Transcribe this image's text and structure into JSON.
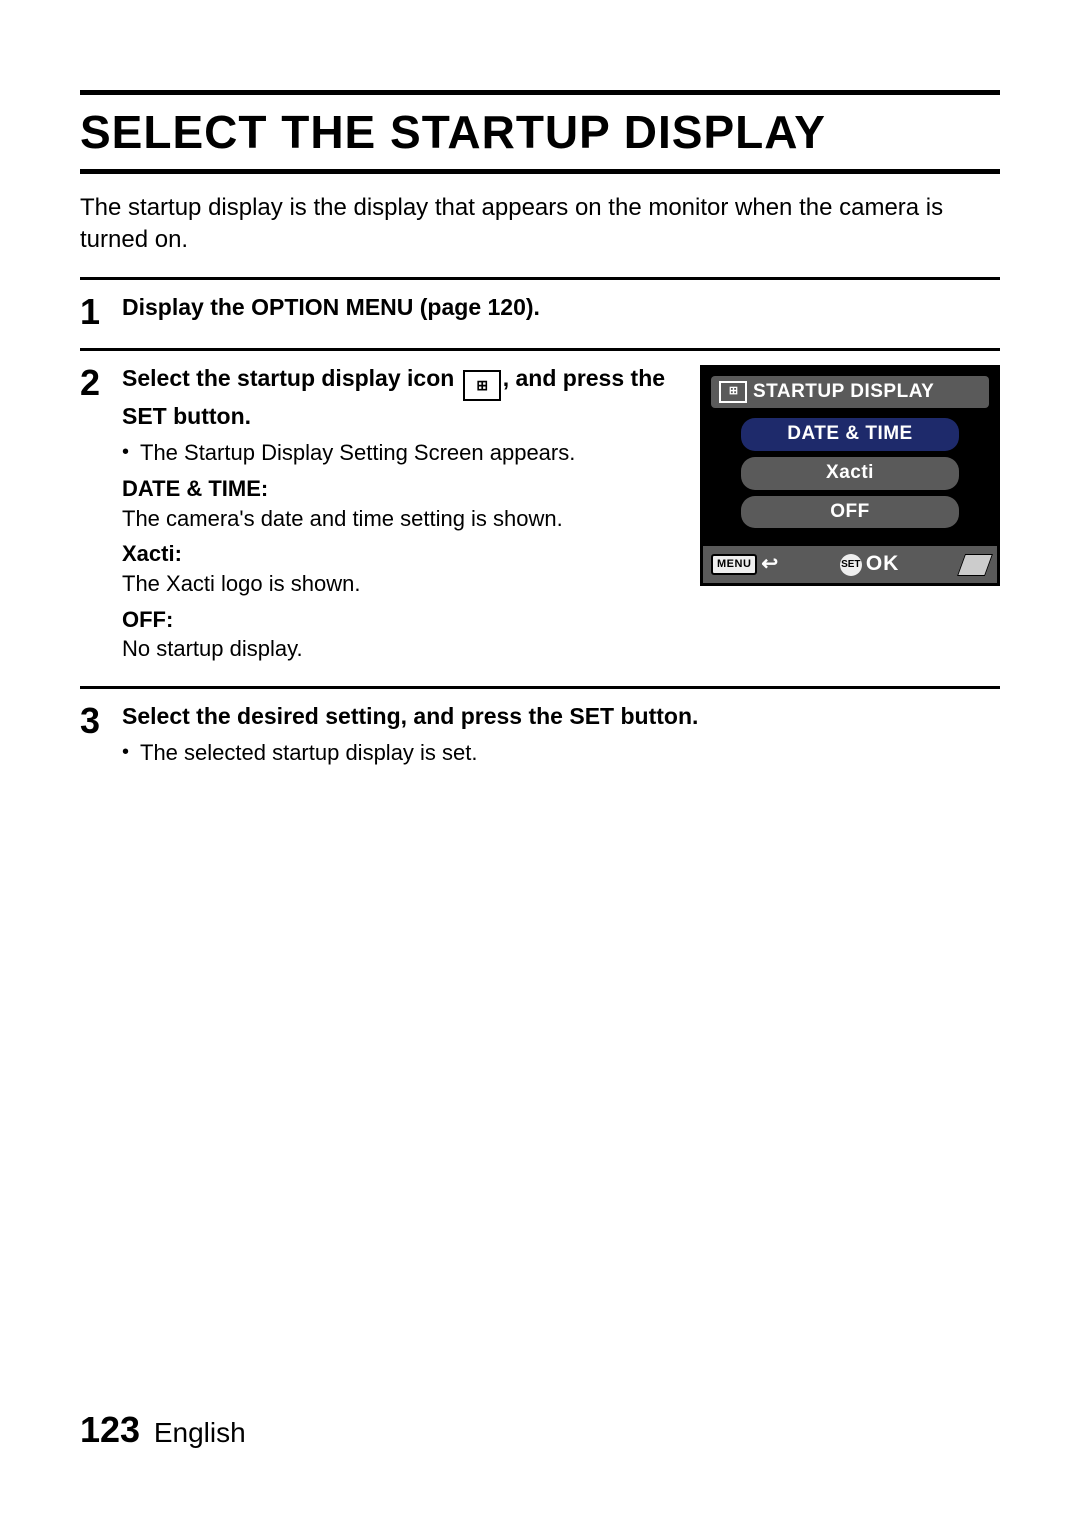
{
  "title": "SELECT THE STARTUP DISPLAY",
  "intro": "The startup display is the display that appears on the monitor when the camera is turned on.",
  "icon_glyph": "⊞",
  "steps": {
    "s1": {
      "num": "1",
      "head": "Display the OPTION MENU (page 120)."
    },
    "s2": {
      "num": "2",
      "head_a": "Select the startup display icon ",
      "head_b": ", and press the SET button.",
      "bullet1": "The Startup Display Setting Screen appears.",
      "dt1": "DATE & TIME:",
      "dd1": "The camera's date and time setting is shown.",
      "dt2": "Xacti:",
      "dd2": "The Xacti logo is shown.",
      "dt3": "OFF:",
      "dd3": "No startup display."
    },
    "s3": {
      "num": "3",
      "head": "Select the desired setting, and press the SET button.",
      "bullet1": "The selected startup display is set."
    }
  },
  "lcd": {
    "title": "STARTUP DISPLAY",
    "opt1": "DATE & TIME",
    "opt2": "Xacti",
    "opt3": "OFF",
    "menu_label": "MENU",
    "set_label": "SET",
    "ok_label": "OK"
  },
  "footer": {
    "page_number": "123",
    "language": "English"
  }
}
